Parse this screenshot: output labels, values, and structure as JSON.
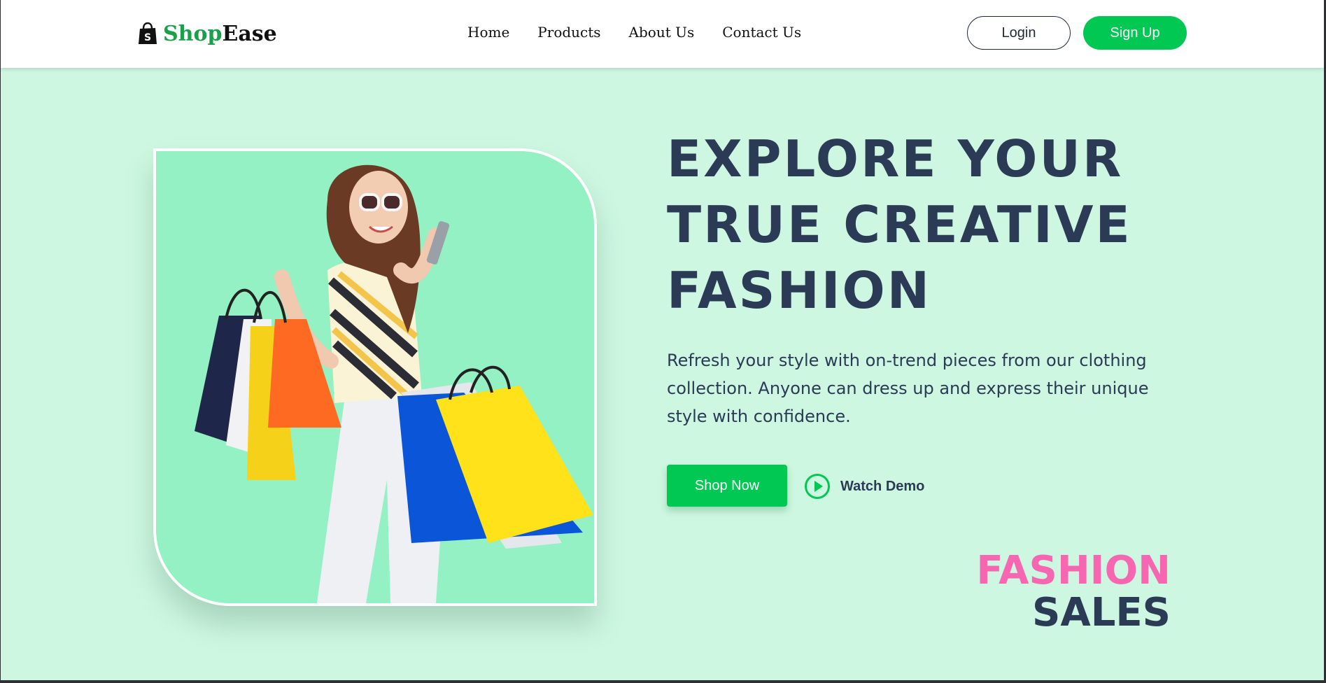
{
  "header": {
    "brand_part1": "Shop",
    "brand_part2": "Ease",
    "nav": [
      "Home",
      "Products",
      "About Us",
      "Contact Us"
    ],
    "login_label": "Login",
    "signup_label": "Sign Up"
  },
  "hero": {
    "headline": [
      "EXPLORE YOUR",
      "TRUE CREATIVE",
      "FASHION"
    ],
    "description": "Refresh your style with on-trend pieces from our clothing collection. Anyone can dress up and express their unique style with confidence.",
    "shop_now_label": "Shop Now",
    "watch_demo_label": "Watch Demo",
    "promo_line1": "FASHION",
    "promo_line2": "SALES"
  },
  "icons": {
    "logo": "shopping-bag-icon",
    "watch_demo": "play-circle-icon"
  },
  "colors": {
    "accent": "#00c853",
    "brand_green": "#1aa04a",
    "page_background": "#cdf7e0",
    "headline": "#2b3a55",
    "promo_pink": "#f767b1",
    "image_background": "#93f1c3"
  }
}
